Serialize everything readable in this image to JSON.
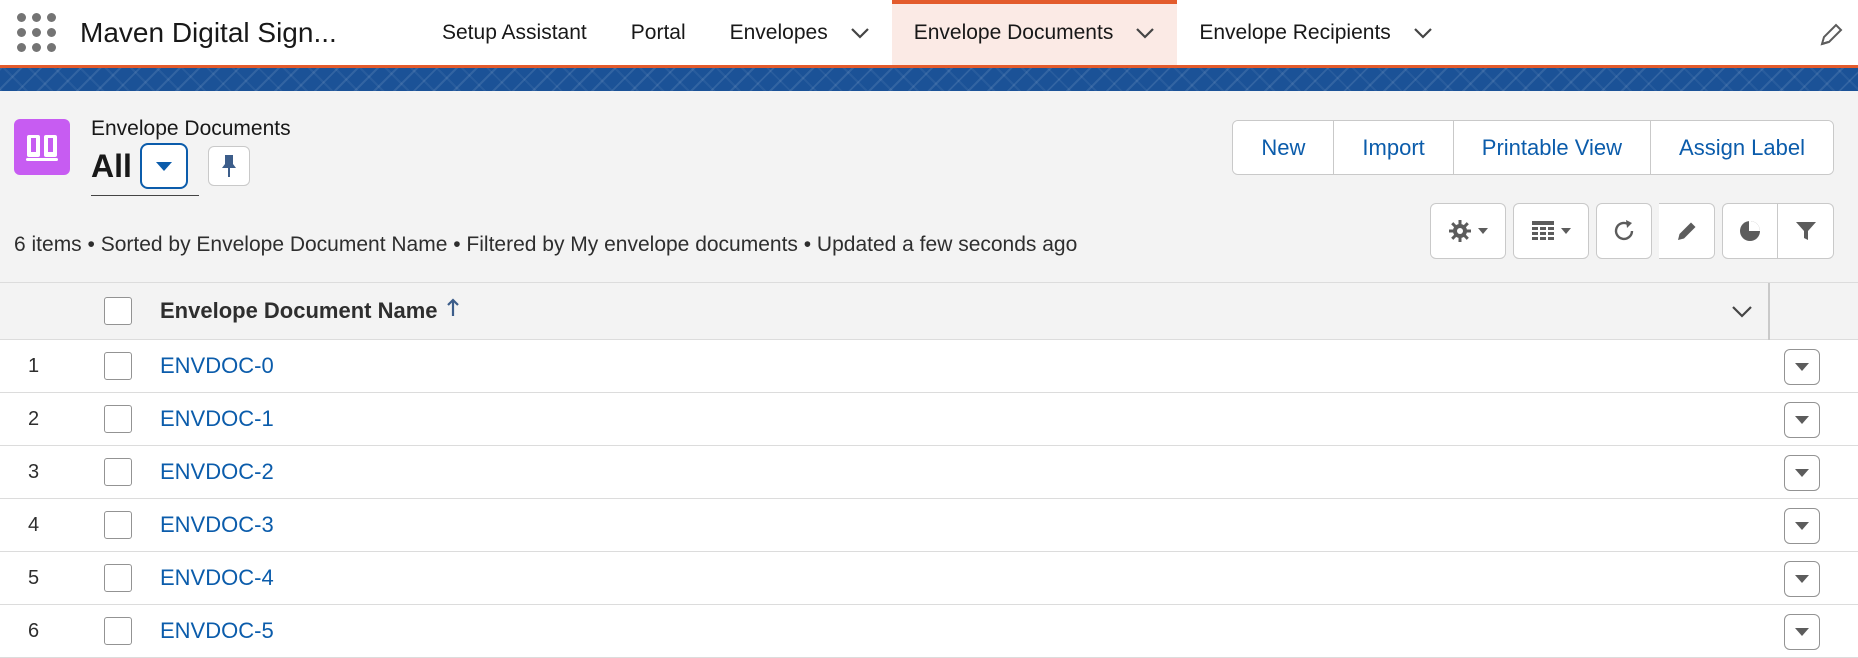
{
  "app": {
    "name": "Maven Digital Sign..."
  },
  "nav": {
    "items": [
      {
        "label": "Setup Assistant",
        "has_menu": false
      },
      {
        "label": "Portal",
        "has_menu": false
      },
      {
        "label": "Envelopes",
        "has_menu": true
      },
      {
        "label": "Envelope Documents",
        "has_menu": true,
        "active": true
      },
      {
        "label": "Envelope Recipients",
        "has_menu": true
      }
    ]
  },
  "header": {
    "object_label": "Envelope Documents",
    "view_name": "All",
    "actions": [
      "New",
      "Import",
      "Printable View",
      "Assign Label"
    ],
    "meta": "6 items • Sorted by Envelope Document Name • Filtered by My envelope documents • Updated a few seconds ago"
  },
  "table": {
    "column_header": "Envelope Document Name",
    "sort_direction": "ascending",
    "rows": [
      {
        "num": "1",
        "name": "ENVDOC-0"
      },
      {
        "num": "2",
        "name": "ENVDOC-1"
      },
      {
        "num": "3",
        "name": "ENVDOC-2"
      },
      {
        "num": "4",
        "name": "ENVDOC-3"
      },
      {
        "num": "5",
        "name": "ENVDOC-4"
      },
      {
        "num": "6",
        "name": "ENVDOC-5"
      }
    ]
  },
  "colors": {
    "accent": "#e35b2c",
    "link": "#0b5cab",
    "object_icon": "#c75cf2",
    "banner": "#1b5297"
  },
  "icons": {
    "app_launcher": "waffle-icon",
    "nav_edit": "pencil-icon",
    "object": "book-icon",
    "pin": "pin-icon",
    "tools": [
      "gear-icon",
      "table-icon",
      "refresh-icon",
      "pencil-icon",
      "pie-chart-icon",
      "filter-icon"
    ]
  }
}
